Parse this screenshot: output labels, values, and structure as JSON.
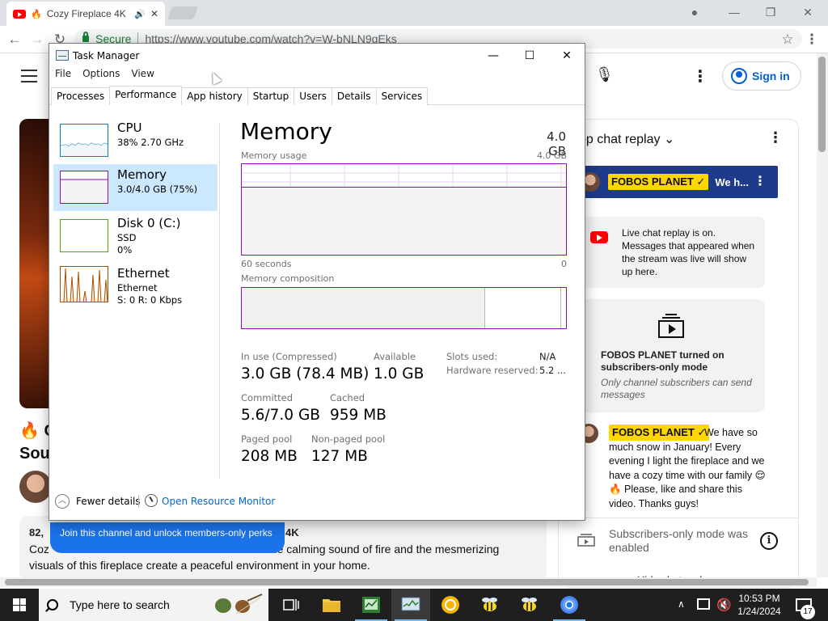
{
  "browser": {
    "tab_title": "Cozy Fireplace 4K",
    "url_secure_label": "Secure",
    "url": "https://www.youtube.com/watch?v=W-bNLN9qEks"
  },
  "youtube": {
    "video_title_line1": "🔥 C",
    "video_title_line2": "Sou",
    "views_partial": "82,",
    "views_tail": "4K",
    "desc_line1": "the calming sound of fire and the mesmerizing",
    "desc_line2": "visuals of this fireplace create a peaceful environment in your home.",
    "desc_prefix": "Coz",
    "join_banner": "Join this channel and unlock members-only perks",
    "sign_in": "Sign in",
    "chat_header": "op chat replay",
    "pinned_author": "FOBOS PLANET ✓",
    "pinned_text": "We h...",
    "replay_notice": "Live chat replay is on. Messages that appeared when the stream was live will show up here.",
    "subonly_title": "FOBOS PLANET turned on subscribers-only mode",
    "subonly_desc": "Only channel subscribers can send messages",
    "msg_author": "FOBOS PLANET ✓",
    "msg_text": "We have so much snow in January! Every evening I light the fireplace and we have a cozy time with our family 😌 🔥 Please, like and share this video. Thanks guys!",
    "subonly_enabled": "Subscribers-only mode was enabled",
    "hide_replay": "Hide chat replay"
  },
  "task_manager": {
    "title": "Task Manager",
    "menu": [
      "File",
      "Options",
      "View"
    ],
    "tabs": [
      "Processes",
      "Performance",
      "App history",
      "Startup",
      "Users",
      "Details",
      "Services"
    ],
    "active_tab": "Performance",
    "resources": [
      {
        "name": "CPU",
        "sub1": "38%  2.70 GHz",
        "sub2": ""
      },
      {
        "name": "Memory",
        "sub1": "3.0/4.0 GB (75%)",
        "sub2": ""
      },
      {
        "name": "Disk 0 (C:)",
        "sub1": "SSD",
        "sub2": "0%"
      },
      {
        "name": "Ethernet",
        "sub1": "Ethernet",
        "sub2": "S: 0  R: 0 Kbps"
      }
    ],
    "memory": {
      "heading": "Memory",
      "total": "4.0 GB",
      "usage_label": "Memory usage",
      "usage_max": "4.0 GB",
      "usage_fraction": 0.75,
      "x_left": "60 seconds",
      "x_right": "0",
      "composition_label": "Memory composition",
      "composition_in_use_fraction": 0.75,
      "composition_modified_fraction": 0.235,
      "in_use_label": "In use (Compressed)",
      "in_use_value": "3.0 GB (78.4 MB)",
      "available_label": "Available",
      "available_value": "1.0 GB",
      "slots_label": "Slots used:",
      "slots_value": "N/A",
      "hw_reserved_label": "Hardware reserved:",
      "hw_reserved_value": "5.2 ...",
      "committed_label": "Committed",
      "committed_value": "5.6/7.0 GB",
      "cached_label": "Cached",
      "cached_value": "959 MB",
      "paged_label": "Paged pool",
      "paged_value": "208 MB",
      "nonpaged_label": "Non-paged pool",
      "nonpaged_value": "127 MB"
    },
    "fewer_details": "Fewer details",
    "open_resource_monitor": "Open Resource Monitor",
    "colors": {
      "memory": "#8b12ae",
      "cpu": "#117dbb",
      "disk": "#4da60c",
      "ethernet": "#a74f01"
    }
  },
  "taskbar": {
    "search_placeholder": "Type here to search",
    "time": "10:53 PM",
    "date": "1/24/2024",
    "notification_count": "17"
  }
}
